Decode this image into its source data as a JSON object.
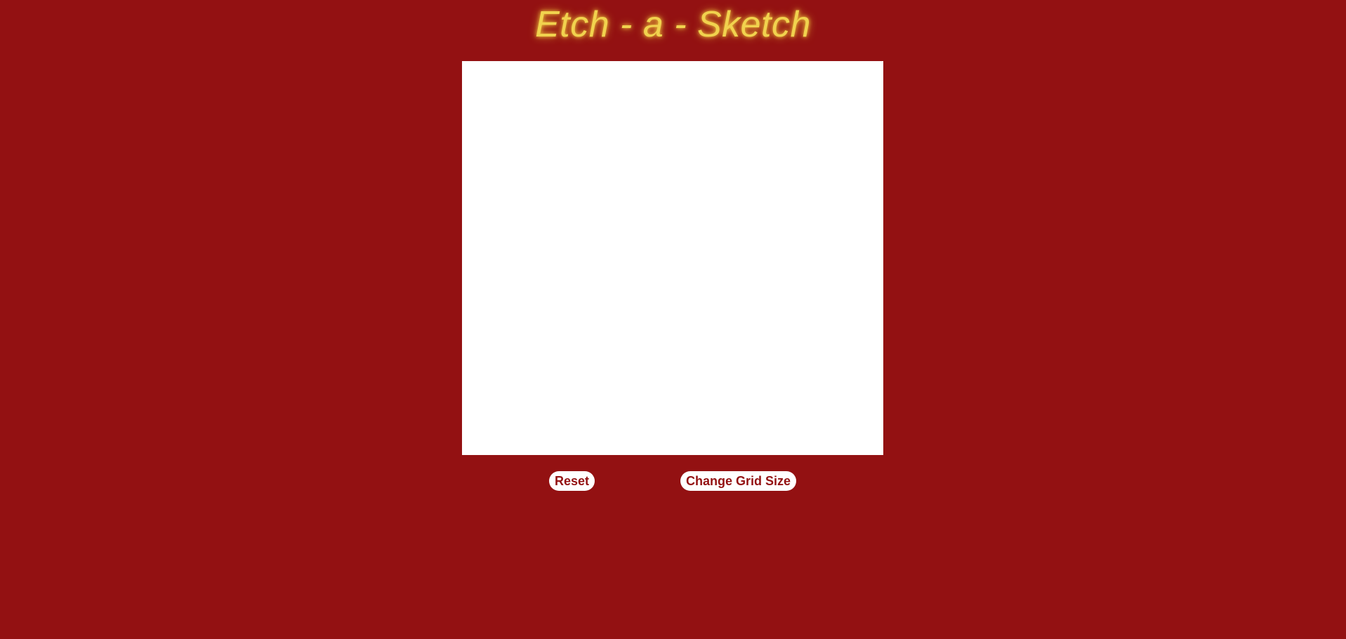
{
  "header": {
    "title": "Etch - a - Sketch"
  },
  "controls": {
    "reset_label": "Reset",
    "grid_size_label": "Change Grid Size"
  },
  "colors": {
    "background": "#931112",
    "title": "#f1d24e",
    "canvas": "#ffffff",
    "button_text": "#931112"
  }
}
